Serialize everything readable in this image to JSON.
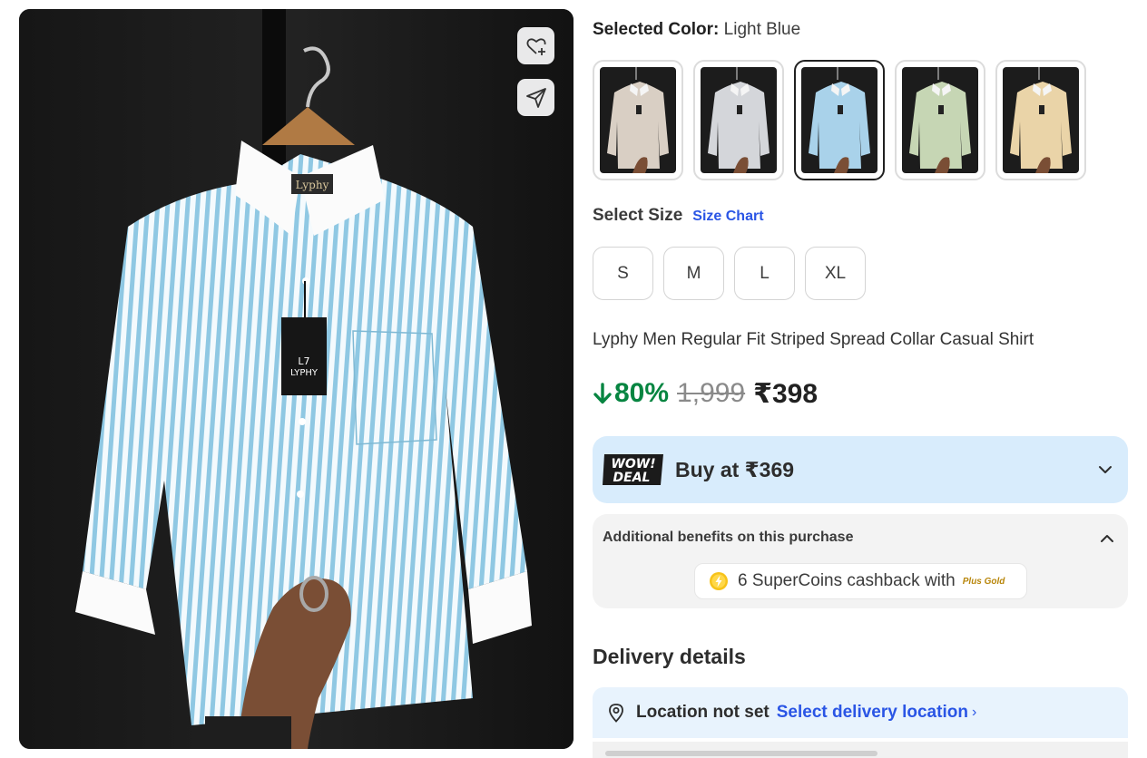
{
  "product_image": {
    "tag_brand": "LYPHY",
    "tag_logo": "L7",
    "collar_label": "Lyphy"
  },
  "icons": {
    "wishlist": "heart-plus-icon",
    "share": "send-icon",
    "deal_expand": "chevron-down-icon",
    "benefits_collapse": "chevron-up-icon",
    "supercoin": "supercoin-icon",
    "location": "map-pin-icon"
  },
  "color_selector": {
    "label": "Selected Color:",
    "value": "Light Blue",
    "options": [
      {
        "shirt_color": "#d9cfc4",
        "selected": false
      },
      {
        "shirt_color": "#d4d6da",
        "selected": false
      },
      {
        "shirt_color": "#a9d2ea",
        "selected": true
      },
      {
        "shirt_color": "#c6d6b4",
        "selected": false
      },
      {
        "shirt_color": "#ead4a8",
        "selected": false
      }
    ]
  },
  "size_selector": {
    "label": "Select Size",
    "chart_link": "Size Chart",
    "sizes": [
      "S",
      "M",
      "L",
      "XL"
    ]
  },
  "product": {
    "title": "Lyphy Men Regular Fit Striped Spread Collar Casual Shirt",
    "discount": "80%",
    "mrp": "1,999",
    "price": "₹398"
  },
  "deal": {
    "logo_line1": "WOW!",
    "logo_line2": "DEAL",
    "text": "Buy at ₹369"
  },
  "benefits": {
    "title": "Additional benefits on this purchase",
    "supercoins_text": "6 SuperCoins cashback with",
    "plus_gold": "Plus Gold"
  },
  "delivery": {
    "title": "Delivery details",
    "location_status": "Location not set",
    "location_link": "Select delivery location",
    "location_arrow": "›"
  },
  "colors": {
    "discount_green": "#078541",
    "link_blue": "#2a55e5",
    "deal_bg": "#d8ecfc",
    "location_bg": "#e8f3fd"
  }
}
